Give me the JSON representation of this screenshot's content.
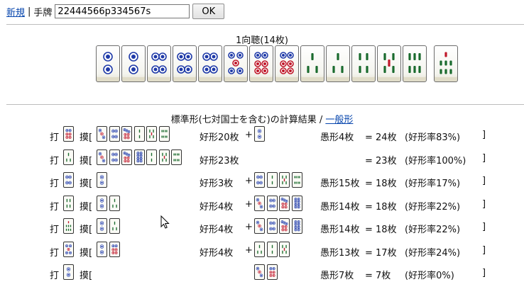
{
  "topbar": {
    "new_link": "新規",
    "separator": "|",
    "hand_label": "手牌",
    "hand_value": "22444566p334567s",
    "ok_label": "OK"
  },
  "shanten": "1向聴(14枚)",
  "big_hand": [
    "2p",
    "2p",
    "4p",
    "4p",
    "4p",
    "5p",
    "6p",
    "6p",
    "3s",
    "3s",
    "4s",
    "5s",
    "6s",
    "7s"
  ],
  "results": {
    "title_prefix": "標準形(七対国士を含む)の計算結果 / ",
    "general_link": "一般形",
    "rows": [
      {
        "discard_label": "打",
        "discard": "6p",
        "draw_label": "摸[",
        "good_tiles": [
          "3p",
          "4p",
          "7p",
          "2s",
          "5s",
          "8s"
        ],
        "good_count": "好形20枚",
        "plus": "+",
        "bad_tiles": [
          "2p"
        ],
        "bad_count": "愚形4枚",
        "total": "= 24枚",
        "rate": "(好形率83%)",
        "close": "]"
      },
      {
        "discard_label": "打",
        "discard": "3s",
        "draw_label": "摸[",
        "good_tiles": [
          "3p",
          "4p",
          "7p",
          "8p",
          "2s",
          "5s",
          "8s"
        ],
        "good_count": "好形23枚",
        "plus": "",
        "bad_tiles": [],
        "bad_count": "",
        "total": "= 23枚",
        "rate": "(好形率100%)",
        "close": "]"
      },
      {
        "discard_label": "打",
        "discard": "4p",
        "draw_label": "摸[",
        "good_tiles": [
          "2p"
        ],
        "good_count": "好形3枚",
        "plus": "+",
        "bad_tiles": [
          "4p",
          "2s",
          "5s",
          "8s"
        ],
        "bad_count": "愚形15枚",
        "total": "= 18枚",
        "rate": "(好形率17%)",
        "close": "]"
      },
      {
        "discard_label": "打",
        "discard": "4s",
        "draw_label": "摸[",
        "good_tiles": [
          "2p",
          "3s"
        ],
        "good_count": "好形4枚",
        "plus": "+",
        "bad_tiles": [
          "3p",
          "4p",
          "7p",
          "8p"
        ],
        "bad_count": "愚形14枚",
        "total": "= 18枚",
        "rate": "(好形率22%)",
        "close": "]"
      },
      {
        "discard_label": "打",
        "discard": "7s",
        "draw_label": "摸[",
        "good_tiles": [
          "2p",
          "3s"
        ],
        "good_count": "好形4枚",
        "plus": "+",
        "bad_tiles": [
          "3p",
          "4p",
          "7p",
          "8p"
        ],
        "bad_count": "愚形14枚",
        "total": "= 18枚",
        "rate": "(好形率22%)",
        "close": "]"
      },
      {
        "discard_label": "打",
        "discard": "5p",
        "draw_label": "摸[",
        "good_tiles": [
          "2p",
          "6p"
        ],
        "good_count": "好形4枚",
        "plus": "+",
        "bad_tiles": [
          "3s",
          "2s",
          "5s"
        ],
        "bad_count": "愚形13枚",
        "total": "= 17枚",
        "rate": "(好形率24%)",
        "close": "]"
      },
      {
        "discard_label": "打",
        "discard": "2p",
        "draw_label": "摸[",
        "good_tiles": [],
        "good_count": "",
        "plus": "",
        "bad_tiles": [
          "3p",
          "6p"
        ],
        "bad_count": "愚形7枚",
        "total": "= 7枚",
        "rate": "(好形率0%)",
        "close": "]"
      }
    ]
  },
  "colors": {
    "link": "#0645ad",
    "pin_blue": "#1f3aa8",
    "pin_red": "#c0182a",
    "sou_green": "#1a6b2e"
  }
}
